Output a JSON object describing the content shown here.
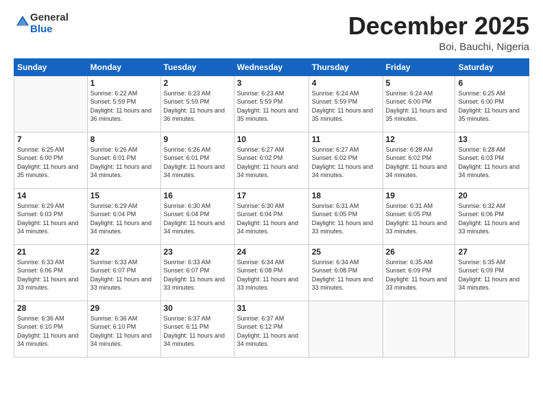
{
  "header": {
    "logo_general": "General",
    "logo_blue": "Blue",
    "month_title": "December 2025",
    "location": "Boi, Bauchi, Nigeria"
  },
  "days_of_week": [
    "Sunday",
    "Monday",
    "Tuesday",
    "Wednesday",
    "Thursday",
    "Friday",
    "Saturday"
  ],
  "weeks": [
    [
      {
        "day": "",
        "sunrise": "",
        "sunset": "",
        "daylight": ""
      },
      {
        "day": "1",
        "sunrise": "Sunrise: 6:22 AM",
        "sunset": "Sunset: 5:59 PM",
        "daylight": "Daylight: 11 hours and 36 minutes."
      },
      {
        "day": "2",
        "sunrise": "Sunrise: 6:23 AM",
        "sunset": "Sunset: 5:59 PM",
        "daylight": "Daylight: 11 hours and 36 minutes."
      },
      {
        "day": "3",
        "sunrise": "Sunrise: 6:23 AM",
        "sunset": "Sunset: 5:59 PM",
        "daylight": "Daylight: 11 hours and 35 minutes."
      },
      {
        "day": "4",
        "sunrise": "Sunrise: 6:24 AM",
        "sunset": "Sunset: 5:59 PM",
        "daylight": "Daylight: 11 hours and 35 minutes."
      },
      {
        "day": "5",
        "sunrise": "Sunrise: 6:24 AM",
        "sunset": "Sunset: 6:00 PM",
        "daylight": "Daylight: 11 hours and 35 minutes."
      },
      {
        "day": "6",
        "sunrise": "Sunrise: 6:25 AM",
        "sunset": "Sunset: 6:00 PM",
        "daylight": "Daylight: 11 hours and 35 minutes."
      }
    ],
    [
      {
        "day": "7",
        "sunrise": "Sunrise: 6:25 AM",
        "sunset": "Sunset: 6:00 PM",
        "daylight": "Daylight: 11 hours and 35 minutes."
      },
      {
        "day": "8",
        "sunrise": "Sunrise: 6:26 AM",
        "sunset": "Sunset: 6:01 PM",
        "daylight": "Daylight: 11 hours and 34 minutes."
      },
      {
        "day": "9",
        "sunrise": "Sunrise: 6:26 AM",
        "sunset": "Sunset: 6:01 PM",
        "daylight": "Daylight: 11 hours and 34 minutes."
      },
      {
        "day": "10",
        "sunrise": "Sunrise: 6:27 AM",
        "sunset": "Sunset: 6:02 PM",
        "daylight": "Daylight: 11 hours and 34 minutes."
      },
      {
        "day": "11",
        "sunrise": "Sunrise: 6:27 AM",
        "sunset": "Sunset: 6:02 PM",
        "daylight": "Daylight: 11 hours and 34 minutes."
      },
      {
        "day": "12",
        "sunrise": "Sunrise: 6:28 AM",
        "sunset": "Sunset: 6:02 PM",
        "daylight": "Daylight: 11 hours and 34 minutes."
      },
      {
        "day": "13",
        "sunrise": "Sunrise: 6:28 AM",
        "sunset": "Sunset: 6:03 PM",
        "daylight": "Daylight: 11 hours and 34 minutes."
      }
    ],
    [
      {
        "day": "14",
        "sunrise": "Sunrise: 6:29 AM",
        "sunset": "Sunset: 6:03 PM",
        "daylight": "Daylight: 11 hours and 34 minutes."
      },
      {
        "day": "15",
        "sunrise": "Sunrise: 6:29 AM",
        "sunset": "Sunset: 6:04 PM",
        "daylight": "Daylight: 11 hours and 34 minutes."
      },
      {
        "day": "16",
        "sunrise": "Sunrise: 6:30 AM",
        "sunset": "Sunset: 6:04 PM",
        "daylight": "Daylight: 11 hours and 34 minutes."
      },
      {
        "day": "17",
        "sunrise": "Sunrise: 6:30 AM",
        "sunset": "Sunset: 6:04 PM",
        "daylight": "Daylight: 11 hours and 34 minutes."
      },
      {
        "day": "18",
        "sunrise": "Sunrise: 6:31 AM",
        "sunset": "Sunset: 6:05 PM",
        "daylight": "Daylight: 11 hours and 33 minutes."
      },
      {
        "day": "19",
        "sunrise": "Sunrise: 6:31 AM",
        "sunset": "Sunset: 6:05 PM",
        "daylight": "Daylight: 11 hours and 33 minutes."
      },
      {
        "day": "20",
        "sunrise": "Sunrise: 6:32 AM",
        "sunset": "Sunset: 6:06 PM",
        "daylight": "Daylight: 11 hours and 33 minutes."
      }
    ],
    [
      {
        "day": "21",
        "sunrise": "Sunrise: 6:33 AM",
        "sunset": "Sunset: 6:06 PM",
        "daylight": "Daylight: 11 hours and 33 minutes."
      },
      {
        "day": "22",
        "sunrise": "Sunrise: 6:33 AM",
        "sunset": "Sunset: 6:07 PM",
        "daylight": "Daylight: 11 hours and 33 minutes."
      },
      {
        "day": "23",
        "sunrise": "Sunrise: 6:33 AM",
        "sunset": "Sunset: 6:07 PM",
        "daylight": "Daylight: 11 hours and 33 minutes."
      },
      {
        "day": "24",
        "sunrise": "Sunrise: 6:34 AM",
        "sunset": "Sunset: 6:08 PM",
        "daylight": "Daylight: 11 hours and 33 minutes."
      },
      {
        "day": "25",
        "sunrise": "Sunrise: 6:34 AM",
        "sunset": "Sunset: 6:08 PM",
        "daylight": "Daylight: 11 hours and 33 minutes."
      },
      {
        "day": "26",
        "sunrise": "Sunrise: 6:35 AM",
        "sunset": "Sunset: 6:09 PM",
        "daylight": "Daylight: 11 hours and 33 minutes."
      },
      {
        "day": "27",
        "sunrise": "Sunrise: 6:35 AM",
        "sunset": "Sunset: 6:09 PM",
        "daylight": "Daylight: 11 hours and 34 minutes."
      }
    ],
    [
      {
        "day": "28",
        "sunrise": "Sunrise: 6:36 AM",
        "sunset": "Sunset: 6:10 PM",
        "daylight": "Daylight: 11 hours and 34 minutes."
      },
      {
        "day": "29",
        "sunrise": "Sunrise: 6:36 AM",
        "sunset": "Sunset: 6:10 PM",
        "daylight": "Daylight: 11 hours and 34 minutes."
      },
      {
        "day": "30",
        "sunrise": "Sunrise: 6:37 AM",
        "sunset": "Sunset: 6:11 PM",
        "daylight": "Daylight: 11 hours and 34 minutes."
      },
      {
        "day": "31",
        "sunrise": "Sunrise: 6:37 AM",
        "sunset": "Sunset: 6:12 PM",
        "daylight": "Daylight: 11 hours and 34 minutes."
      },
      {
        "day": "",
        "sunrise": "",
        "sunset": "",
        "daylight": ""
      },
      {
        "day": "",
        "sunrise": "",
        "sunset": "",
        "daylight": ""
      },
      {
        "day": "",
        "sunrise": "",
        "sunset": "",
        "daylight": ""
      }
    ]
  ]
}
